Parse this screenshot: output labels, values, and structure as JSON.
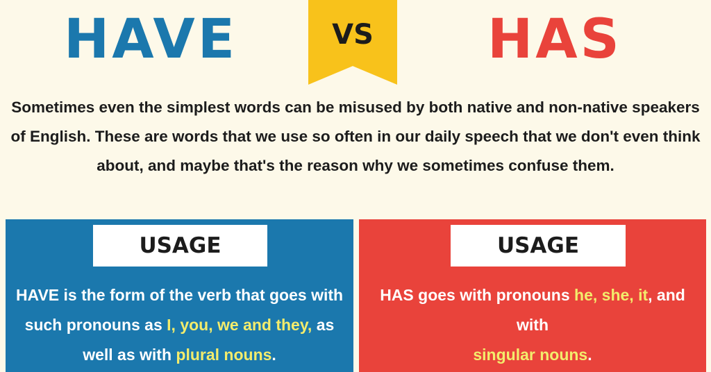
{
  "header": {
    "word_left": "HAVE",
    "vs_label": "VS",
    "word_right": "HAS"
  },
  "intro_text": "Sometimes even the simplest words can be misused by both native and non-native speakers of English. These are words that we use so often in our daily speech that we don't even think about, and maybe that's the reason why we sometimes confuse them.",
  "panels": {
    "left": {
      "heading": "USAGE",
      "t1": "HAVE is the form of the verb that goes with such pronouns as ",
      "h1": "I, you, we and they,",
      "t2": " as well as with ",
      "h2": "plural nouns",
      "t3": "."
    },
    "right": {
      "heading": "USAGE",
      "t1": "HAS goes with pronouns ",
      "h1": "he, she, it",
      "t2": ", and with ",
      "h2": "singular nouns",
      "t3": "."
    }
  },
  "colors": {
    "have_blue": "#1b78ad",
    "has_red": "#e9433b",
    "vs_yellow": "#f8c21b",
    "highlight": "#f3ec6c",
    "background": "#fdf9e9"
  }
}
